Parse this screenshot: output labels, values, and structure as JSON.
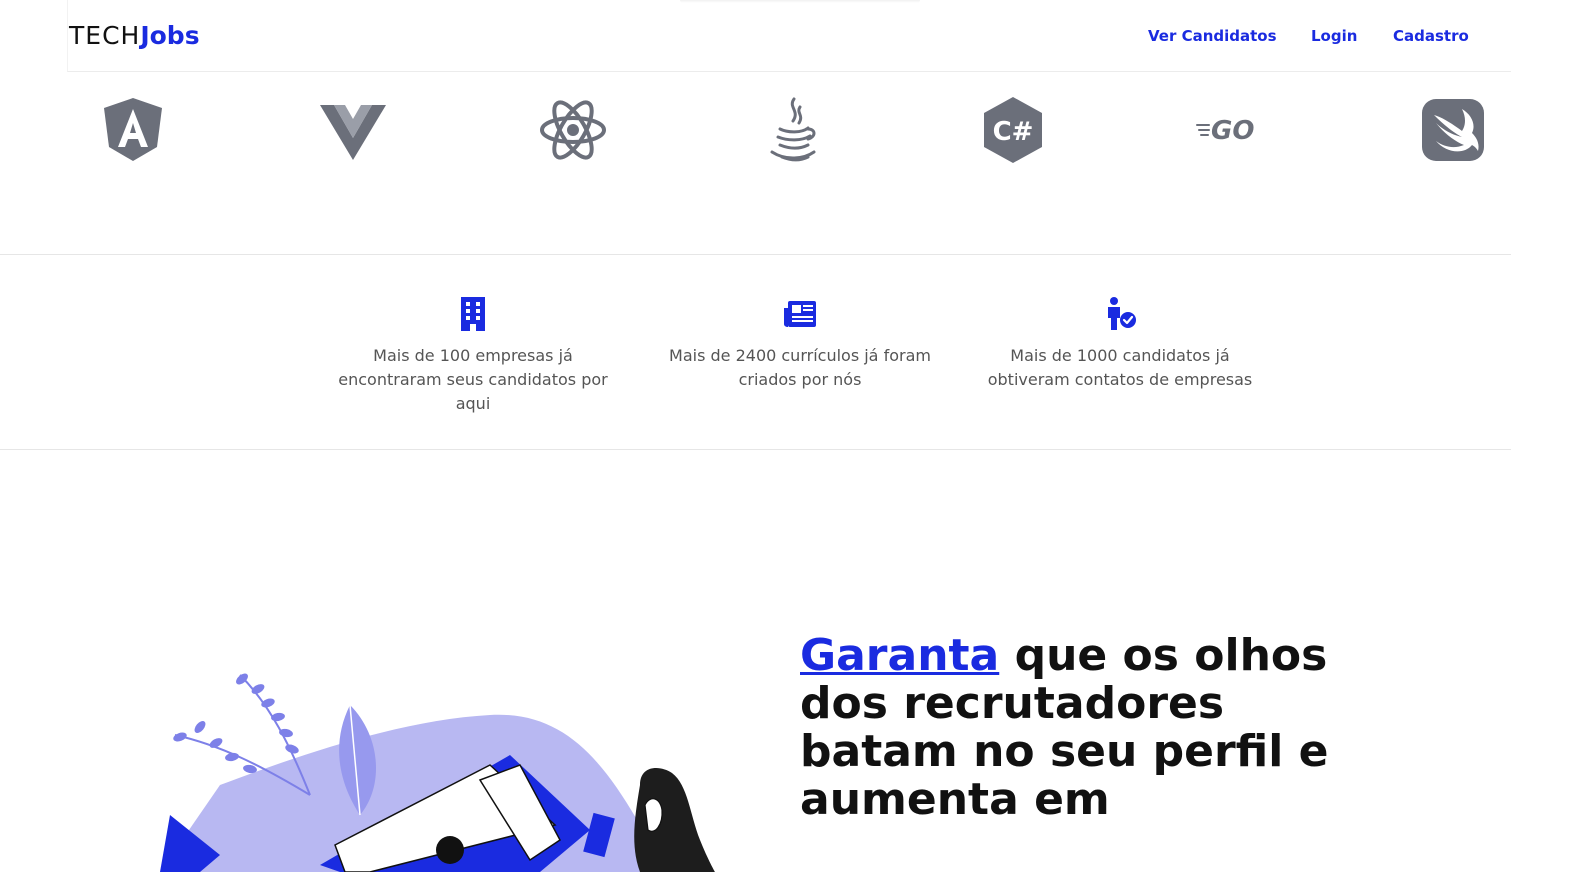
{
  "header": {
    "logo": {
      "part1": "TECH",
      "part2": "Jobs"
    },
    "nav": [
      {
        "label": "Ver Candidatos"
      },
      {
        "label": "Login"
      },
      {
        "label": "Cadastro"
      }
    ]
  },
  "tech_icons": [
    {
      "icon": "angular-icon"
    },
    {
      "icon": "vue-icon"
    },
    {
      "icon": "react-icon"
    },
    {
      "icon": "java-icon"
    },
    {
      "icon": "csharp-icon",
      "text": "C#"
    },
    {
      "icon": "go-icon",
      "text": "GO"
    },
    {
      "icon": "swift-icon"
    }
  ],
  "stats": [
    {
      "icon": "building-icon",
      "text": "Mais de 100 empresas já encontraram seus candidatos por aqui"
    },
    {
      "icon": "newspaper-icon",
      "text": "Mais de 2400 currículos já foram criados por nós"
    },
    {
      "icon": "person-check-icon",
      "text": "Mais de 1000 candidatos já obtiveram contatos de empresas"
    }
  ],
  "hero": {
    "headline_highlight": "Garanta",
    "headline_rest": " que os olhos dos recrutadores batam no seu perfil e aumenta em"
  },
  "colors": {
    "brand": "#1a2be0",
    "icon_gray": "#6b6f7a",
    "illustration_lavender": "#b8b8f2"
  }
}
